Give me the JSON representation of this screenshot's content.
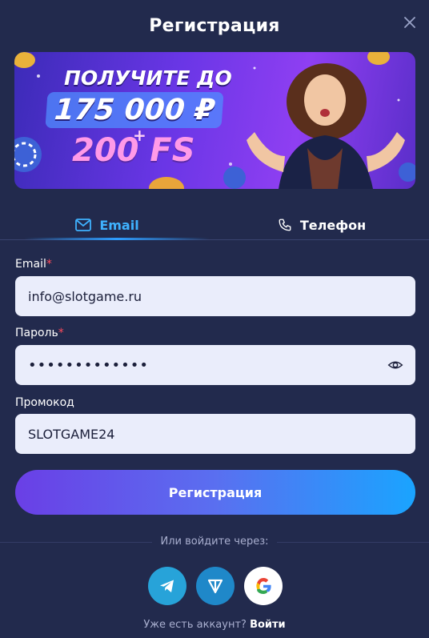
{
  "modal": {
    "title": "Регистрация"
  },
  "banner": {
    "line1": "ПОЛУЧИТЕ ДО",
    "line2": "175 000 ₽",
    "plus": "+",
    "line3": "200 FS"
  },
  "tabs": [
    {
      "label": "Email",
      "icon": "mail-icon",
      "active": true
    },
    {
      "label": "Телефон",
      "icon": "phone-icon",
      "active": false
    }
  ],
  "form": {
    "email_label": "Email",
    "email_value": "info@slotgame.ru",
    "password_label": "Пароль",
    "password_value": "•••••••••••••",
    "promo_label": "Промокод",
    "promo_value": "SLOTGAME24",
    "required_mark": "*",
    "submit_label": "Регистрация"
  },
  "social": {
    "or_text": "Или войдите через:",
    "providers": [
      "telegram-icon",
      "ton-icon",
      "google-icon"
    ]
  },
  "footer": {
    "question": "Уже есть аккаунт?",
    "login_label": "Войти"
  },
  "colors": {
    "background": "#222a4d",
    "accent": "#2e9dff",
    "required": "#ff4b5c",
    "field_bg": "#eaedfb"
  }
}
